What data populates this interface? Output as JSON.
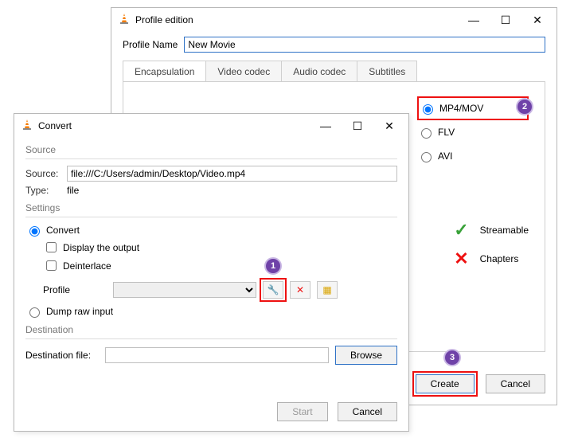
{
  "profile_window": {
    "title": "Profile edition",
    "name_label": "Profile Name",
    "name_value": "New Movie",
    "tabs": {
      "encapsulation": "Encapsulation",
      "video_codec": "Video codec",
      "audio_codec": "Audio codec",
      "subtitles": "Subtitles"
    },
    "options": {
      "mp4mov": "MP4/MOV",
      "flv": "FLV",
      "avi": "AVI"
    },
    "features": {
      "streamable": "Streamable",
      "chapters": "Chapters"
    },
    "buttons": {
      "create": "Create",
      "cancel": "Cancel"
    }
  },
  "convert_window": {
    "title": "Convert",
    "groups": {
      "source": "Source",
      "settings": "Settings",
      "destination": "Destination"
    },
    "source": {
      "label": "Source:",
      "value": "file:///C:/Users/admin/Desktop/Video.mp4",
      "type_label": "Type:",
      "type_value": "file"
    },
    "settings": {
      "convert": "Convert",
      "display_output": "Display the output",
      "deinterlace": "Deinterlace",
      "profile_label": "Profile",
      "dump": "Dump raw input"
    },
    "destination": {
      "label": "Destination file:",
      "browse": "Browse"
    },
    "buttons": {
      "start": "Start",
      "cancel": "Cancel"
    }
  },
  "callouts": {
    "one": "1",
    "two": "2",
    "three": "3"
  }
}
